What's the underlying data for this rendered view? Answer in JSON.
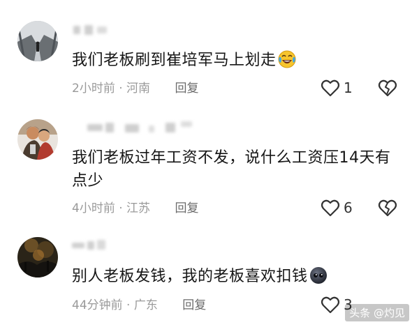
{
  "comments": [
    {
      "text": "我们老板刷到崔培军马上划走",
      "emoji": "crying-laughing-emoji",
      "time": "2小时前",
      "location": "河南",
      "reply_label": "回复",
      "likes": "1"
    },
    {
      "text": "我们老板过年工资不发，说什么工资压14天有点少",
      "time": "4小时前",
      "location": "江苏",
      "reply_label": "回复",
      "likes": "6"
    },
    {
      "text": "别人老板发钱，我的老板喜欢扣钱",
      "emoji": "dark-face-emoji",
      "time": "44分钟前",
      "location": "广东",
      "reply_label": "回复",
      "likes": "3"
    }
  ],
  "separator": " · ",
  "watermark": "头条 @灼见",
  "colors": {
    "text": "#161616",
    "meta": "#9a9a9a",
    "reply": "#6b6b6b"
  }
}
